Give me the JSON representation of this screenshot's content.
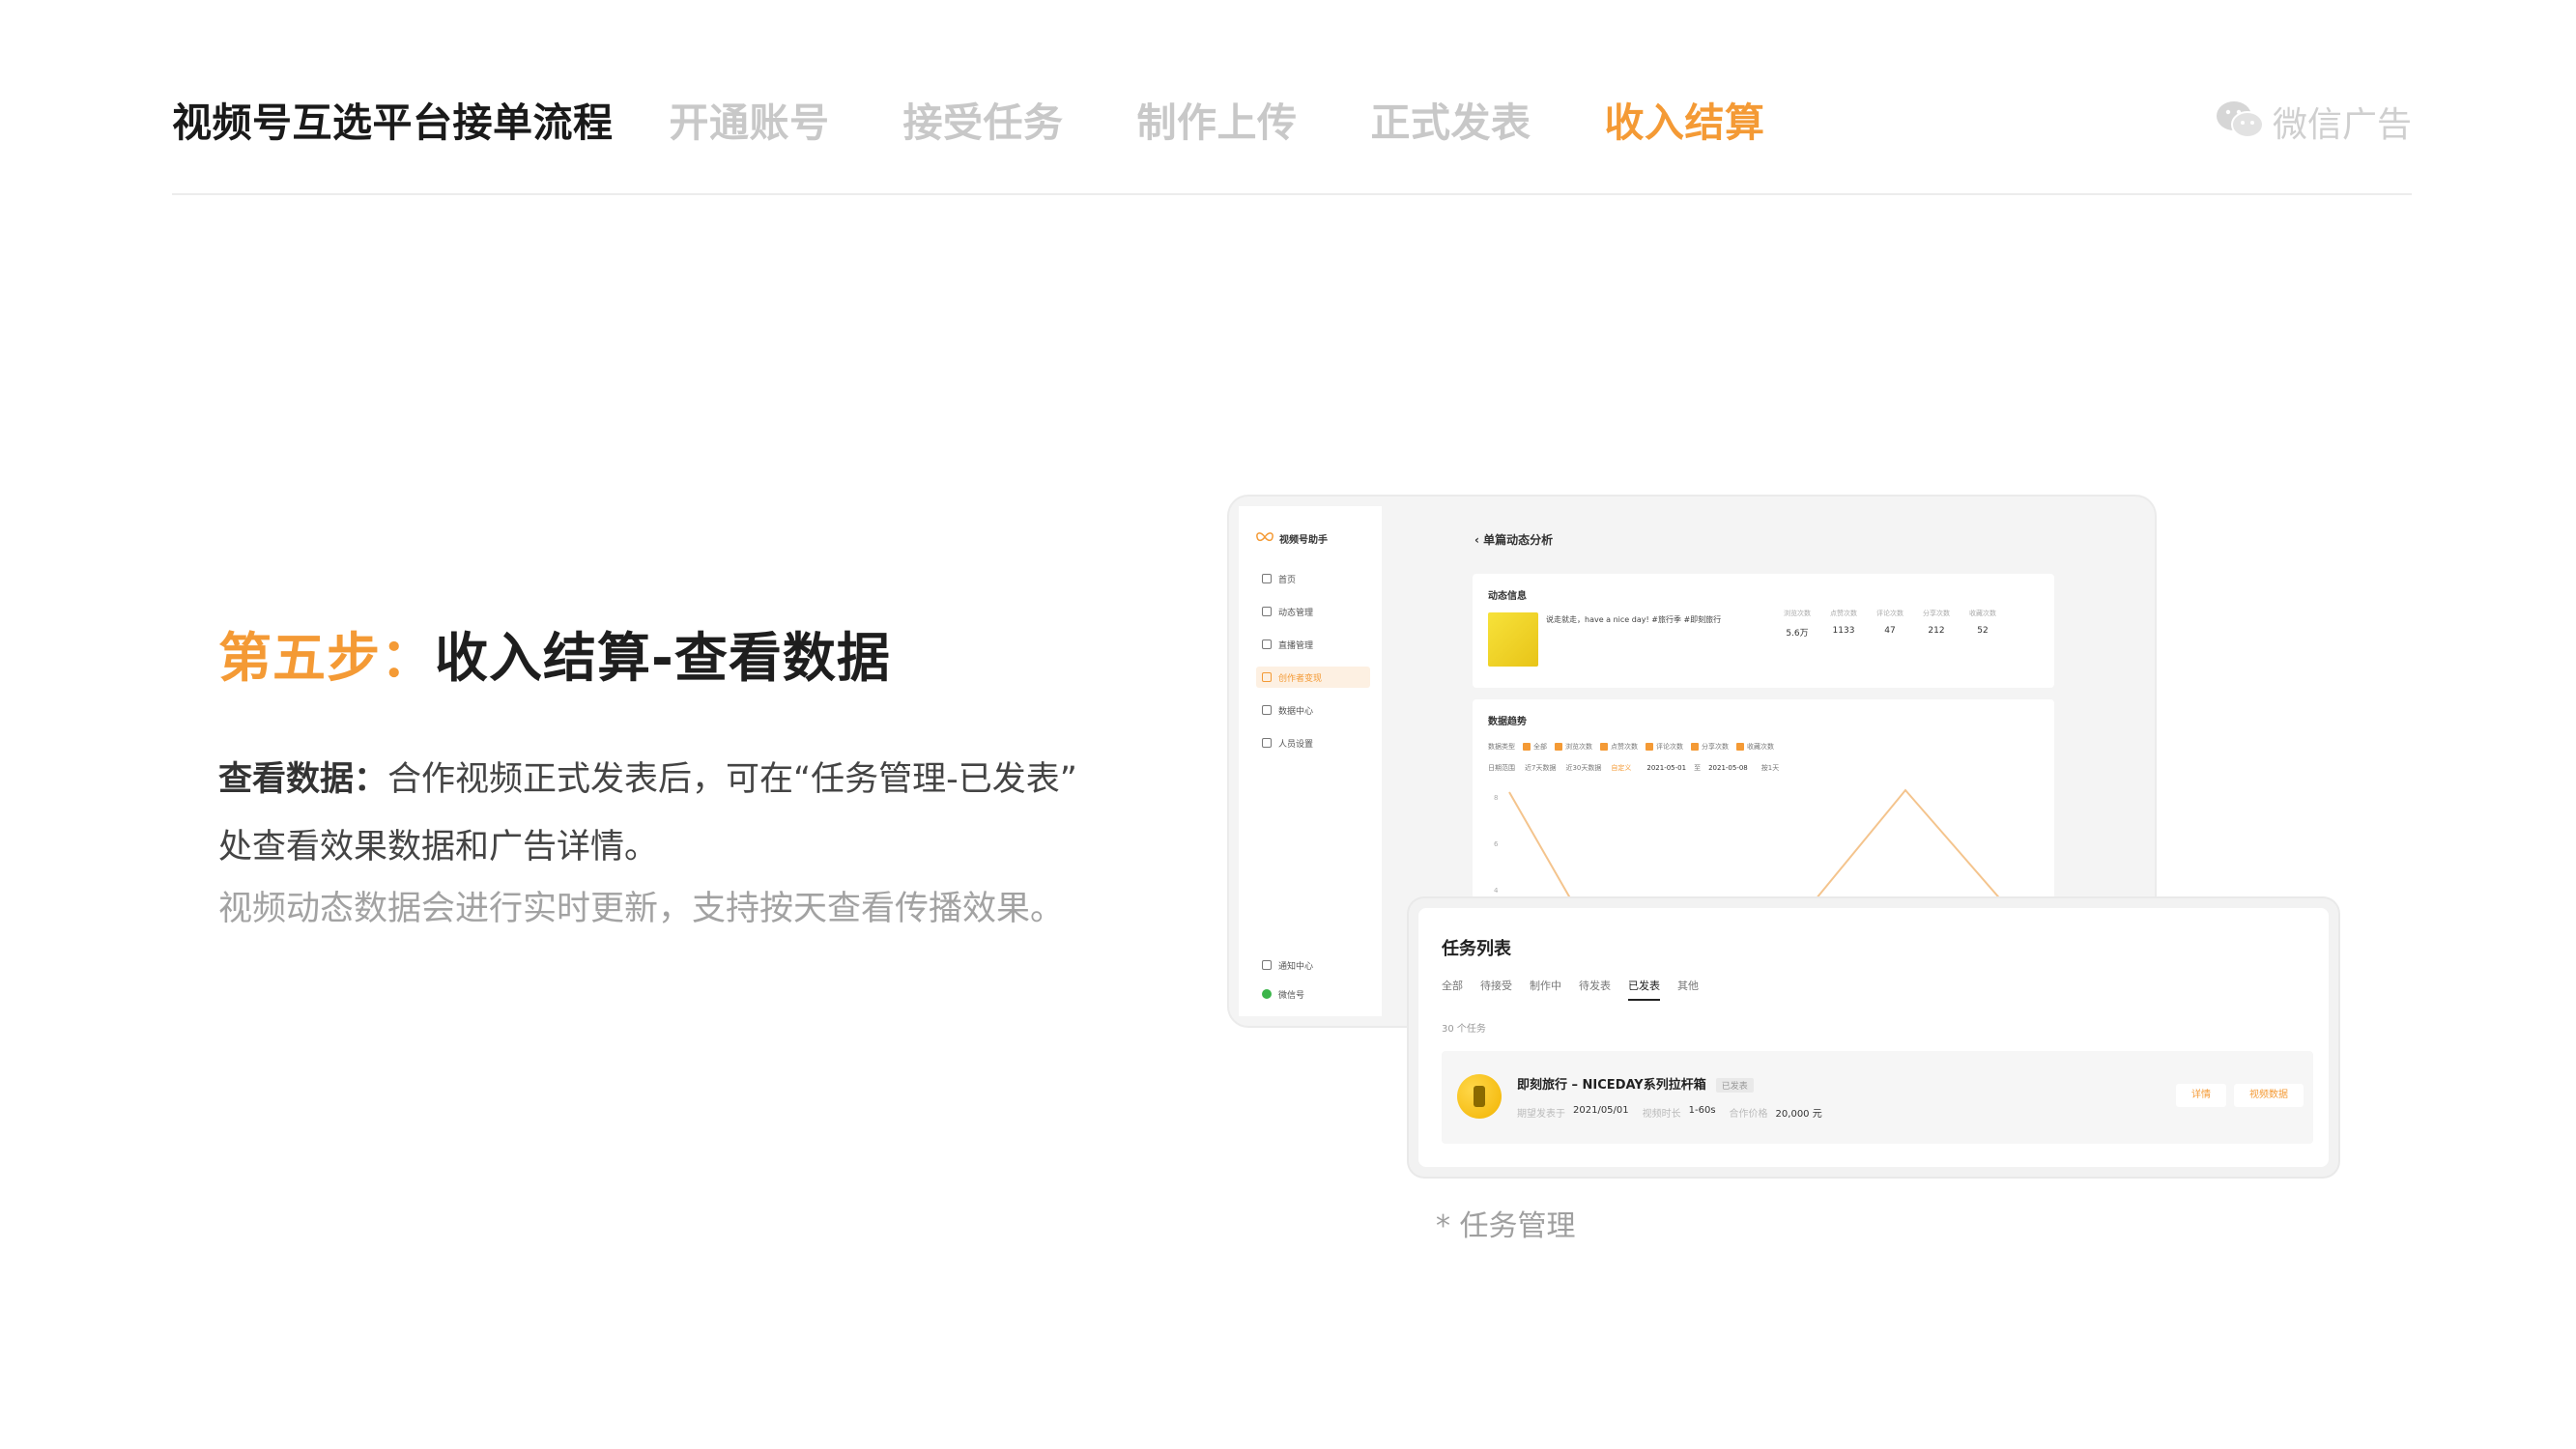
{
  "header": {
    "title": "视频号互选平台接单流程",
    "steps": [
      "开通账号",
      "接受任务",
      "制作上传",
      "正式发表",
      "收入结算"
    ],
    "active_step": "收入结算",
    "brand": "微信广告"
  },
  "section": {
    "heading_prefix": "第五步：",
    "heading_main": "收入结算-查看数据",
    "desc_bold": "查看数据：",
    "desc_line1": "合作视频正式发表后，可在“任务管理-已发表”",
    "desc_line2": "处查看效果数据和广告详情。",
    "desc_sub": "视频动态数据会进行实时更新，支持按天查看传播效果。"
  },
  "app_window": {
    "app_name": "视频号助手",
    "nav": [
      "首页",
      "动态管理",
      "直播管理",
      "创作者变现",
      "数据中心",
      "人员设置"
    ],
    "nav_active": "创作者变现",
    "nav_bottom": [
      "通知中心",
      "微信号"
    ],
    "page_title": "单篇动态分析",
    "card1_title": "动态信息",
    "post_text": "说走就走，have a nice day! #旅行季 #即刻旅行",
    "stats": [
      {
        "label": "浏览次数",
        "value": "5.6万"
      },
      {
        "label": "点赞次数",
        "value": "1133"
      },
      {
        "label": "评论次数",
        "value": "47"
      },
      {
        "label": "分享次数",
        "value": "212"
      },
      {
        "label": "收藏次数",
        "value": "52"
      }
    ],
    "card2_title": "数据趋势",
    "filter_label": "数据类型",
    "filters": [
      "全部",
      "浏览次数",
      "点赞次数",
      "评论次数",
      "分享次数",
      "收藏次数"
    ],
    "range_label": "日期范围",
    "range_options": [
      "近7天数据",
      "近30天数据",
      "自定义"
    ],
    "date_from": "2021-05-01",
    "date_to": "2021-05-08",
    "range_sep": "至",
    "range_tail": "按1天",
    "y_ticks": [
      "8",
      "6",
      "4"
    ]
  },
  "task_window": {
    "title": "任务列表",
    "tabs": [
      "全部",
      "待接受",
      "制作中",
      "待发表",
      "已发表",
      "其他"
    ],
    "active_tab": "已发表",
    "count": "30 个任务",
    "task": {
      "name": "即刻旅行 – NICEDAY系列拉杆箱",
      "status": "已发表",
      "publish_label": "期望发表于",
      "publish_value": "2021/05/01",
      "duration_label": "视频时长",
      "duration_value": "1-60s",
      "price_label": "合作价格",
      "price_value": "20,000 元",
      "btn_detail": "详情",
      "btn_data": "视频数据"
    }
  },
  "caption": "* 任务管理",
  "colors": {
    "accent": "#f49a35",
    "muted": "#c8c8c8"
  }
}
